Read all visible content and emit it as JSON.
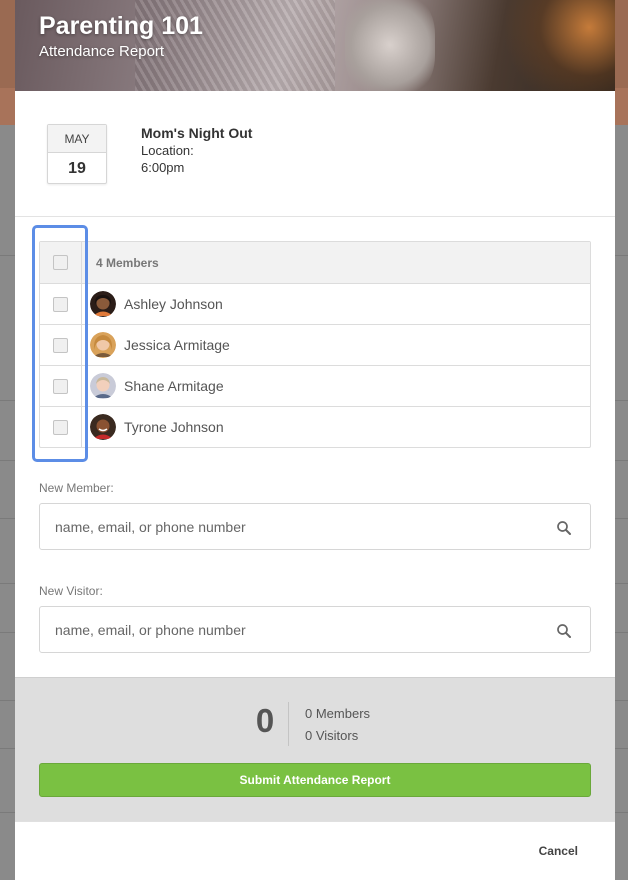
{
  "hero": {
    "title": "Parenting 101",
    "subtitle": "Attendance Report"
  },
  "event": {
    "month": "MAY",
    "day": "19",
    "title": "Mom's Night Out",
    "location": "Location:",
    "time": "6:00pm"
  },
  "members": {
    "header": "4 Members",
    "list": [
      {
        "name": "Ashley Johnson",
        "avatar_icon": "person-avatar-icon"
      },
      {
        "name": "Jessica Armitage",
        "avatar_icon": "person-avatar-icon"
      },
      {
        "name": "Shane Armitage",
        "avatar_icon": "person-avatar-icon"
      },
      {
        "name": "Tyrone Johnson",
        "avatar_icon": "person-avatar-icon"
      }
    ]
  },
  "new_member": {
    "label": "New Member:",
    "placeholder": "name, email, or phone number"
  },
  "new_visitor": {
    "label": "New Visitor:",
    "placeholder": "name, email, or phone number"
  },
  "summary": {
    "total": "0",
    "members": "0 Members",
    "visitors": "0 Visitors"
  },
  "actions": {
    "submit": "Submit Attendance Report",
    "cancel": "Cancel"
  },
  "colors": {
    "accent_green": "#7ac142",
    "selection_blue": "#5c8de6"
  }
}
